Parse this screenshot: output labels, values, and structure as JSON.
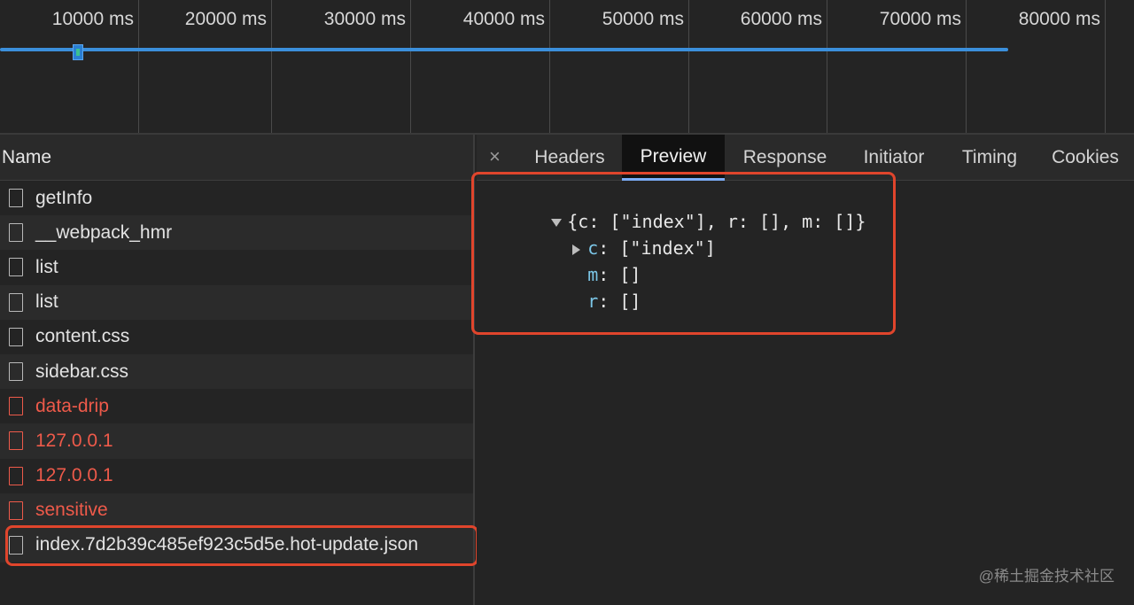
{
  "timeline": {
    "ticks": [
      "10000 ms",
      "20000 ms",
      "30000 ms",
      "40000 ms",
      "50000 ms",
      "60000 ms",
      "70000 ms",
      "80000 ms"
    ]
  },
  "request_list": {
    "header": "Name",
    "rows": [
      {
        "name": "getInfo",
        "status": "ok"
      },
      {
        "name": "__webpack_hmr",
        "status": "ok"
      },
      {
        "name": "list",
        "status": "ok"
      },
      {
        "name": "list",
        "status": "ok"
      },
      {
        "name": "content.css",
        "status": "ok"
      },
      {
        "name": "sidebar.css",
        "status": "ok"
      },
      {
        "name": "data-drip",
        "status": "error"
      },
      {
        "name": "127.0.0.1",
        "status": "error"
      },
      {
        "name": "127.0.0.1",
        "status": "error"
      },
      {
        "name": "sensitive",
        "status": "error"
      },
      {
        "name": "index.7d2b39c485ef923c5d5e.hot-update.json",
        "status": "ok",
        "highlighted": true
      }
    ]
  },
  "details": {
    "close_icon": "×",
    "tabs": [
      "Headers",
      "Preview",
      "Response",
      "Initiator",
      "Timing",
      "Cookies"
    ],
    "active_tab": "Preview",
    "preview": {
      "root_summary": "{c: [\"index\"], r: [], m: []}",
      "entries": [
        {
          "key": "c",
          "sep": ": ",
          "value": "[\"index\"]",
          "expandable": true
        },
        {
          "key": "m",
          "sep": ": ",
          "value": "[]",
          "expandable": false
        },
        {
          "key": "r",
          "sep": ": ",
          "value": "[]",
          "expandable": false
        }
      ]
    }
  },
  "colors": {
    "error_text": "#ee5a4a",
    "highlight_outline": "#e0452c",
    "timeline_bar": "#3b8fdb",
    "json_key": "#7cc7e8"
  },
  "watermark": "@稀土掘金技术社区"
}
